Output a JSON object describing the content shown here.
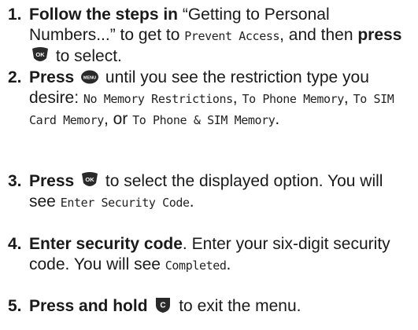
{
  "steps": [
    {
      "number": "1.",
      "parts": {
        "a_bold": "Follow the steps in",
        "b_text": " “Getting to Personal Numbers...” to get to ",
        "c_lcd": "Prevent Access",
        "d_text": ", and then ",
        "e_bold": "press",
        "f_text": " to select.",
        "key_icon": "ok-key-icon",
        "key_label": "OK"
      }
    },
    {
      "number": "2.",
      "parts": {
        "a_bold": "Press",
        "b_text": " until you see the restriction type you desire: ",
        "c_lcd": "No Memory Restrictions",
        "d_text": ", ",
        "e_lcd": "To Phone Memory",
        "f_text": ", ",
        "g_lcd": "To SIM Card Memory",
        "h_text": ", or ",
        "i_lcd": "To Phone & SIM Memory",
        "j_text": ".",
        "key_icon": "menu-key-icon",
        "key_label": "MENU"
      }
    },
    {
      "number": "3.",
      "parts": {
        "a_bold": "Press",
        "b_text": " to select the displayed option. You will see ",
        "c_lcd": "Enter Security Code",
        "d_text": ".",
        "key_icon": "ok-key-icon",
        "key_label": "OK"
      }
    },
    {
      "number": "4.",
      "parts": {
        "a_bold": "Enter security code",
        "b_text": ". Enter your six-digit security code. You will see ",
        "c_lcd": "Completed",
        "d_text": "."
      }
    },
    {
      "number": "5.",
      "parts": {
        "a_bold": "Press and hold",
        "b_text": " to exit the menu.",
        "key_icon": "clear-key-icon",
        "key_label": "C"
      }
    }
  ],
  "colors": {
    "text": "#1a1a1a",
    "key_fill": "#2a2a2a",
    "key_label": "#ffffff"
  }
}
